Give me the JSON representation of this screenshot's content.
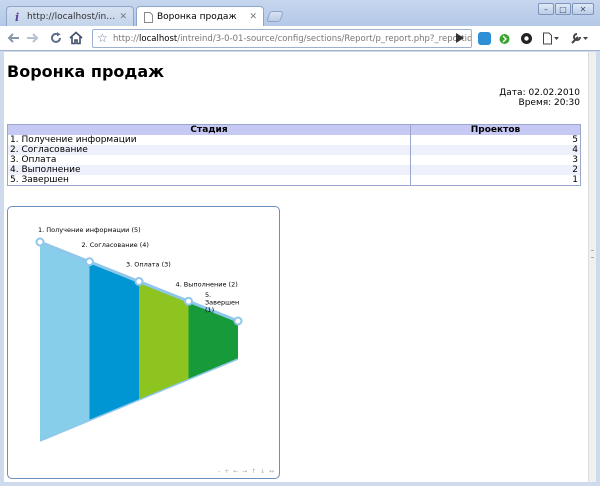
{
  "browser": {
    "tabs": [
      {
        "label": "http://localhost/intrein...",
        "active": false
      },
      {
        "label": "Воронка продаж",
        "active": true
      }
    ],
    "url_prefix": "http://",
    "url_host": "localhost",
    "url_path": "/intreind/3-0-01-source/config/sections/Report/p_report.php?_reportid=085d"
  },
  "page": {
    "title": "Воронка продаж",
    "date_line": "Дата: 02.02.2010",
    "time_line": "Время: 20:30"
  },
  "table": {
    "headers": [
      "Стадия",
      "Проектов"
    ],
    "rows": [
      {
        "stage": "1. Получение информации",
        "count": "5"
      },
      {
        "stage": "2. Согласование",
        "count": "4"
      },
      {
        "stage": "3. Оплата",
        "count": "3"
      },
      {
        "stage": "4. Выполнение",
        "count": "2"
      },
      {
        "stage": "5. Завершен",
        "count": "1"
      }
    ]
  },
  "chart_data": {
    "type": "funnel",
    "categories": [
      "1. Получение информации",
      "2. Согласование",
      "3. Оплата",
      "4. Выполнение",
      "5. Завершен"
    ],
    "values": [
      5,
      4,
      3,
      2,
      1
    ],
    "labels": [
      "1. Получение информации (5)",
      "2. Согласование (4)",
      "3. Оплата (3)",
      "4. Выполнение (2)",
      "5. Завершен (1)"
    ],
    "colors": [
      "#87ceeb",
      "#0095d3",
      "#8dc41f",
      "#179b3a"
    ],
    "marker_color": "#8ec7ea"
  },
  "chart_nav": "- + ← → ↑ ↓ ↔"
}
